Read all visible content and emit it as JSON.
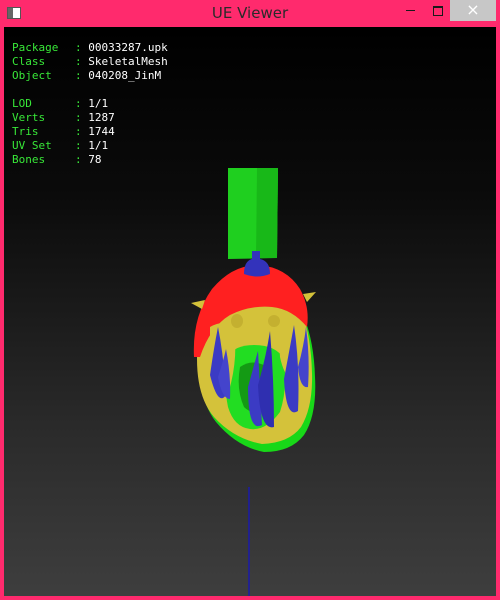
{
  "window": {
    "title": "UE Viewer",
    "controls": {
      "minimize_icon": "minimize-icon",
      "maximize_icon": "maximize-icon",
      "close_label": "×"
    }
  },
  "info": {
    "package": {
      "label": "Package",
      "value": "00033287.upk"
    },
    "class": {
      "label": "Class",
      "value": "SkeletalMesh"
    },
    "object": {
      "label": "Object",
      "value": "040208_JinM"
    },
    "lod": {
      "label": "LOD",
      "value": "1/1"
    },
    "verts": {
      "label": "Verts",
      "value": "1287"
    },
    "tris": {
      "label": "Tris",
      "value": "1744"
    },
    "uvset": {
      "label": "UV Set",
      "value": "1/1"
    },
    "bones": {
      "label": "Bones",
      "value": "78"
    }
  },
  "colors": {
    "frame": "#ff2a6d",
    "info_label": "#38e838",
    "info_value": "#ffffff",
    "mesh_red": "#ff2222",
    "mesh_yellow": "#d6c23c",
    "mesh_green": "#22dd22",
    "mesh_blue": "#3333bb"
  }
}
